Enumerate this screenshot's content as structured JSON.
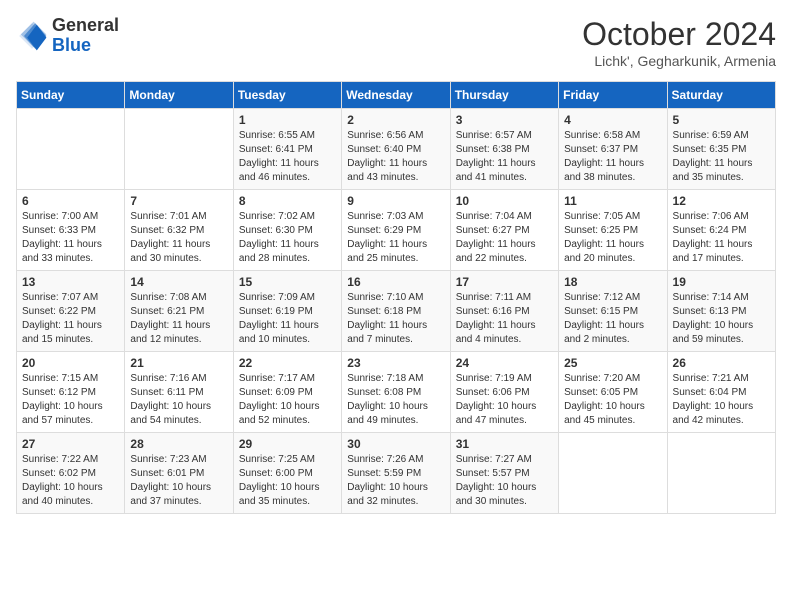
{
  "header": {
    "logo_general": "General",
    "logo_blue": "Blue",
    "month_title": "October 2024",
    "subtitle": "Lichk', Gegharkunik, Armenia"
  },
  "weekdays": [
    "Sunday",
    "Monday",
    "Tuesday",
    "Wednesday",
    "Thursday",
    "Friday",
    "Saturday"
  ],
  "weeks": [
    [
      {
        "day": "",
        "content": ""
      },
      {
        "day": "",
        "content": ""
      },
      {
        "day": "1",
        "content": "Sunrise: 6:55 AM\nSunset: 6:41 PM\nDaylight: 11 hours and 46 minutes."
      },
      {
        "day": "2",
        "content": "Sunrise: 6:56 AM\nSunset: 6:40 PM\nDaylight: 11 hours and 43 minutes."
      },
      {
        "day": "3",
        "content": "Sunrise: 6:57 AM\nSunset: 6:38 PM\nDaylight: 11 hours and 41 minutes."
      },
      {
        "day": "4",
        "content": "Sunrise: 6:58 AM\nSunset: 6:37 PM\nDaylight: 11 hours and 38 minutes."
      },
      {
        "day": "5",
        "content": "Sunrise: 6:59 AM\nSunset: 6:35 PM\nDaylight: 11 hours and 35 minutes."
      }
    ],
    [
      {
        "day": "6",
        "content": "Sunrise: 7:00 AM\nSunset: 6:33 PM\nDaylight: 11 hours and 33 minutes."
      },
      {
        "day": "7",
        "content": "Sunrise: 7:01 AM\nSunset: 6:32 PM\nDaylight: 11 hours and 30 minutes."
      },
      {
        "day": "8",
        "content": "Sunrise: 7:02 AM\nSunset: 6:30 PM\nDaylight: 11 hours and 28 minutes."
      },
      {
        "day": "9",
        "content": "Sunrise: 7:03 AM\nSunset: 6:29 PM\nDaylight: 11 hours and 25 minutes."
      },
      {
        "day": "10",
        "content": "Sunrise: 7:04 AM\nSunset: 6:27 PM\nDaylight: 11 hours and 22 minutes."
      },
      {
        "day": "11",
        "content": "Sunrise: 7:05 AM\nSunset: 6:25 PM\nDaylight: 11 hours and 20 minutes."
      },
      {
        "day": "12",
        "content": "Sunrise: 7:06 AM\nSunset: 6:24 PM\nDaylight: 11 hours and 17 minutes."
      }
    ],
    [
      {
        "day": "13",
        "content": "Sunrise: 7:07 AM\nSunset: 6:22 PM\nDaylight: 11 hours and 15 minutes."
      },
      {
        "day": "14",
        "content": "Sunrise: 7:08 AM\nSunset: 6:21 PM\nDaylight: 11 hours and 12 minutes."
      },
      {
        "day": "15",
        "content": "Sunrise: 7:09 AM\nSunset: 6:19 PM\nDaylight: 11 hours and 10 minutes."
      },
      {
        "day": "16",
        "content": "Sunrise: 7:10 AM\nSunset: 6:18 PM\nDaylight: 11 hours and 7 minutes."
      },
      {
        "day": "17",
        "content": "Sunrise: 7:11 AM\nSunset: 6:16 PM\nDaylight: 11 hours and 4 minutes."
      },
      {
        "day": "18",
        "content": "Sunrise: 7:12 AM\nSunset: 6:15 PM\nDaylight: 11 hours and 2 minutes."
      },
      {
        "day": "19",
        "content": "Sunrise: 7:14 AM\nSunset: 6:13 PM\nDaylight: 10 hours and 59 minutes."
      }
    ],
    [
      {
        "day": "20",
        "content": "Sunrise: 7:15 AM\nSunset: 6:12 PM\nDaylight: 10 hours and 57 minutes."
      },
      {
        "day": "21",
        "content": "Sunrise: 7:16 AM\nSunset: 6:11 PM\nDaylight: 10 hours and 54 minutes."
      },
      {
        "day": "22",
        "content": "Sunrise: 7:17 AM\nSunset: 6:09 PM\nDaylight: 10 hours and 52 minutes."
      },
      {
        "day": "23",
        "content": "Sunrise: 7:18 AM\nSunset: 6:08 PM\nDaylight: 10 hours and 49 minutes."
      },
      {
        "day": "24",
        "content": "Sunrise: 7:19 AM\nSunset: 6:06 PM\nDaylight: 10 hours and 47 minutes."
      },
      {
        "day": "25",
        "content": "Sunrise: 7:20 AM\nSunset: 6:05 PM\nDaylight: 10 hours and 45 minutes."
      },
      {
        "day": "26",
        "content": "Sunrise: 7:21 AM\nSunset: 6:04 PM\nDaylight: 10 hours and 42 minutes."
      }
    ],
    [
      {
        "day": "27",
        "content": "Sunrise: 7:22 AM\nSunset: 6:02 PM\nDaylight: 10 hours and 40 minutes."
      },
      {
        "day": "28",
        "content": "Sunrise: 7:23 AM\nSunset: 6:01 PM\nDaylight: 10 hours and 37 minutes."
      },
      {
        "day": "29",
        "content": "Sunrise: 7:25 AM\nSunset: 6:00 PM\nDaylight: 10 hours and 35 minutes."
      },
      {
        "day": "30",
        "content": "Sunrise: 7:26 AM\nSunset: 5:59 PM\nDaylight: 10 hours and 32 minutes."
      },
      {
        "day": "31",
        "content": "Sunrise: 7:27 AM\nSunset: 5:57 PM\nDaylight: 10 hours and 30 minutes."
      },
      {
        "day": "",
        "content": ""
      },
      {
        "day": "",
        "content": ""
      }
    ]
  ]
}
